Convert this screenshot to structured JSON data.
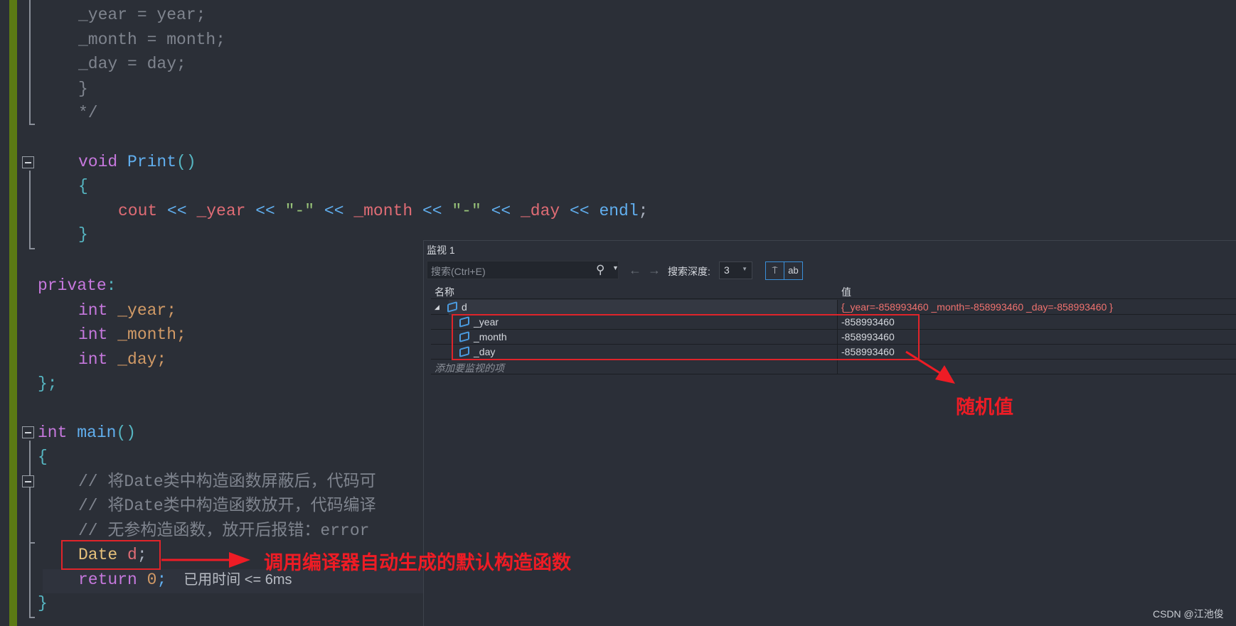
{
  "code": {
    "lines": {
      "l0": "_year = year;",
      "l1": "_month = month;",
      "l2": "_day = day;",
      "l3": "}",
      "l4": "*/",
      "l6a": "void ",
      "l6b": "Print",
      "l6c": "()",
      "l7": "{",
      "l8a": "cout",
      "l8b": " << ",
      "l8c": "_year",
      "l8d": " << ",
      "l8e": "\"-\"",
      "l8f": " << ",
      "l8g": "_month",
      "l8h": " << ",
      "l8i": "\"-\"",
      "l8j": " << ",
      "l8k": "_day",
      "l8l": " << ",
      "l8m": "endl",
      "l8n": ";",
      "l9": "}",
      "l11a": "private",
      "l11b": ":",
      "int": "int",
      "l12": " _year;",
      "l13": " _month;",
      "l14": " _day;",
      "l15": "};",
      "l17a": "int",
      "l17b": " main",
      "l17c": "()",
      "l18": "{",
      "l19": "// 将Date类中构造函数屏蔽后，代码可",
      "l20": "// 将Date类中构造函数放开，代码编译",
      "l21": "// 无参构造函数，放开后报错：error",
      "l22a": "Date",
      "l22b": " d",
      ";": ";",
      "l23a": "return",
      "l23b": " 0",
      "l23c": ";",
      "l24": "}"
    },
    "elapsed_hint": "已用时间 <= 6ms"
  },
  "watch": {
    "title": "监视 1",
    "search_placeholder": "搜索(Ctrl+E)",
    "depth_label": "搜索深度:",
    "depth_value": "3",
    "col_name": "名称",
    "col_value": "值",
    "rows": [
      {
        "name": "d",
        "value": "{_year=-858993460 _month=-858993460 _day=-858993460 }"
      },
      {
        "name": "_year",
        "value": "-858993460"
      },
      {
        "name": "_month",
        "value": "-858993460"
      },
      {
        "name": "_day",
        "value": "-858993460"
      }
    ],
    "add_item_placeholder": "添加要监视的项"
  },
  "annotations": {
    "random_value": "随机值",
    "default_ctor": "调用编译器自动生成的默认构造函数"
  },
  "watermark": "CSDN @江池俊",
  "colors": {
    "annotation": "#ee1c25",
    "accent": "#3a8fd9",
    "change_bar": "#5b7a14"
  }
}
